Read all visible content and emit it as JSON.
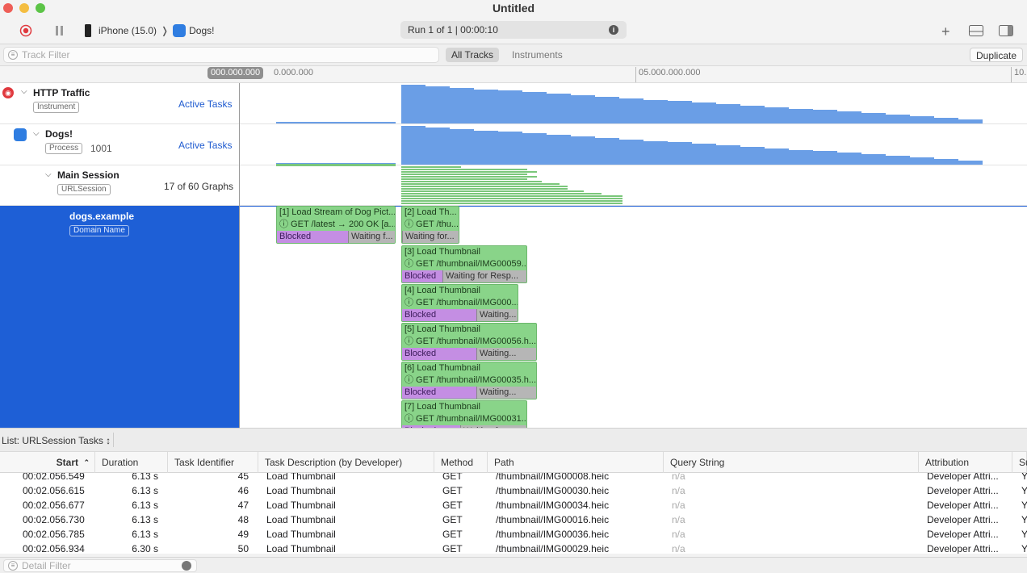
{
  "window": {
    "title": "Untitled"
  },
  "toolbar": {
    "device": "iPhone (15.0)",
    "app": "Dogs!",
    "run": "Run 1 of 1  |  00:00:10"
  },
  "filter": {
    "placeholder": "Track Filter",
    "all_tracks": "All Tracks",
    "instruments": "Instruments",
    "duplicate": "Duplicate"
  },
  "ruler": {
    "t0": "000.000.000",
    "t0b": "0.000.000",
    "t5": "05.000.000.000",
    "t10": "10."
  },
  "tracks": {
    "http": {
      "name": "HTTP Traffic",
      "type": "Instrument",
      "graph": "Active Tasks"
    },
    "dogs": {
      "name": "Dogs!",
      "type": "Process",
      "pid": "1001",
      "graph": "Active Tasks"
    },
    "session": {
      "name": "Main Session",
      "type": "URLSession",
      "graphs": "17 of 60 Graphs"
    },
    "domain": {
      "name": "dogs.example",
      "type": "Domain Name"
    }
  },
  "tasks": [
    {
      "line1": "[1] Load Stream of Dog Pict...",
      "line2": "ⓘ GET /latest → 200 OK [a...",
      "blocked": "Blocked",
      "waiting": "Waiting f..."
    },
    {
      "line1": "[2] Load Th...",
      "line2": "ⓘ GET /thu...",
      "blocked": "",
      "waiting": "Waiting for..."
    },
    {
      "line1": "[3] Load Thumbnail",
      "line2": "ⓘ GET /thumbnail/IMG00059...",
      "blocked": "Blocked",
      "waiting": "Waiting for Resp..."
    },
    {
      "line1": "[4] Load Thumbnail",
      "line2": "ⓘ GET /thumbnail/IMG000...",
      "blocked": "Blocked",
      "waiting": "Waiting..."
    },
    {
      "line1": "[5] Load Thumbnail",
      "line2": "ⓘ GET /thumbnail/IMG00056.h...",
      "blocked": "Blocked",
      "waiting": "Waiting..."
    },
    {
      "line1": "[6] Load Thumbnail",
      "line2": "ⓘ GET /thumbnail/IMG00035.h...",
      "blocked": "Blocked",
      "waiting": "Waiting..."
    },
    {
      "line1": "[7] Load Thumbnail",
      "line2": "ⓘ GET /thumbnail/IMG00031....",
      "blocked": "Blocked",
      "waiting": "Waiting for..."
    }
  ],
  "list": {
    "title": "List: URLSession Tasks ↕",
    "detail_placeholder": "Detail Filter"
  },
  "columns": [
    "Start",
    "Duration",
    "Task Identifier",
    "Task Description (by Developer)",
    "Method",
    "Path",
    "Query String",
    "Attribution",
    "Su"
  ],
  "rows": [
    {
      "start": "00:02.056.549",
      "duration": "6.13 s",
      "id": "45",
      "desc": "Load Thumbnail",
      "method": "GET",
      "path": "/thumbnail/IMG00008.heic",
      "query": "n/a",
      "attr": "Developer Attri...",
      "s": "Y"
    },
    {
      "start": "00:02.056.615",
      "duration": "6.13 s",
      "id": "46",
      "desc": "Load Thumbnail",
      "method": "GET",
      "path": "/thumbnail/IMG00030.heic",
      "query": "n/a",
      "attr": "Developer Attri...",
      "s": "Y"
    },
    {
      "start": "00:02.056.677",
      "duration": "6.13 s",
      "id": "47",
      "desc": "Load Thumbnail",
      "method": "GET",
      "path": "/thumbnail/IMG00034.heic",
      "query": "n/a",
      "attr": "Developer Attri...",
      "s": "Y"
    },
    {
      "start": "00:02.056.730",
      "duration": "6.13 s",
      "id": "48",
      "desc": "Load Thumbnail",
      "method": "GET",
      "path": "/thumbnail/IMG00016.heic",
      "query": "n/a",
      "attr": "Developer Attri...",
      "s": "Y"
    },
    {
      "start": "00:02.056.785",
      "duration": "6.13 s",
      "id": "49",
      "desc": "Load Thumbnail",
      "method": "GET",
      "path": "/thumbnail/IMG00036.heic",
      "query": "n/a",
      "attr": "Developer Attri...",
      "s": "Y"
    },
    {
      "start": "00:02.056.934",
      "duration": "6.30 s",
      "id": "50",
      "desc": "Load Thumbnail",
      "method": "GET",
      "path": "/thumbnail/IMG00029.heic",
      "query": "n/a",
      "attr": "Developer Attri...",
      "s": "Y"
    }
  ],
  "colors": {
    "selection": "#1e5fd6",
    "graph": "#6a9ee6",
    "task": "#89d489",
    "blocked": "#c48ee3",
    "waiting": "#b6b6b6",
    "record": "#e0393e"
  }
}
